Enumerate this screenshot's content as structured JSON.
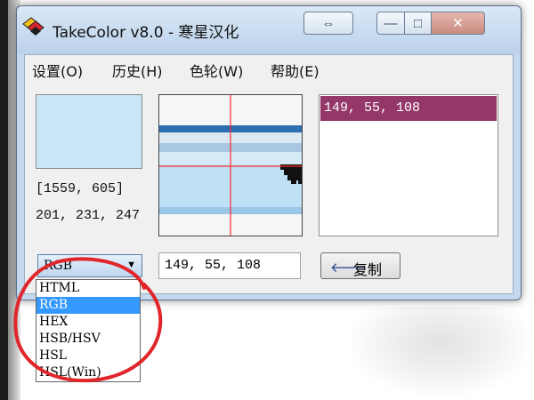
{
  "window": {
    "title": "TakeColor v8.0 - 寒星汉化",
    "controls": {
      "swap": "⇔",
      "minimize": "—",
      "maximize": "□",
      "close": "✕"
    }
  },
  "menu": [
    "设置(O)",
    "历史(H)",
    "色轮(W)",
    "帮助(E)"
  ],
  "picker": {
    "swatch_color": "#c9e7f7",
    "coords": "[1559, 605]",
    "rgb": "201, 231, 247"
  },
  "history": {
    "items": [
      {
        "text": "149, 55, 108",
        "color": "#943769"
      }
    ]
  },
  "format": {
    "selected": "RGB",
    "options": [
      "HTML",
      "RGB",
      "HEX",
      "HSB/HSV",
      "HSL",
      "HSL(Win)"
    ],
    "highlight_color": "#3399ff"
  },
  "output": {
    "value": "149, 55, 108"
  },
  "copy_button": {
    "label": "复制",
    "icon": "left-arrow-icon"
  },
  "annotation": {
    "color": "#e0262b",
    "shape": "ellipse"
  }
}
